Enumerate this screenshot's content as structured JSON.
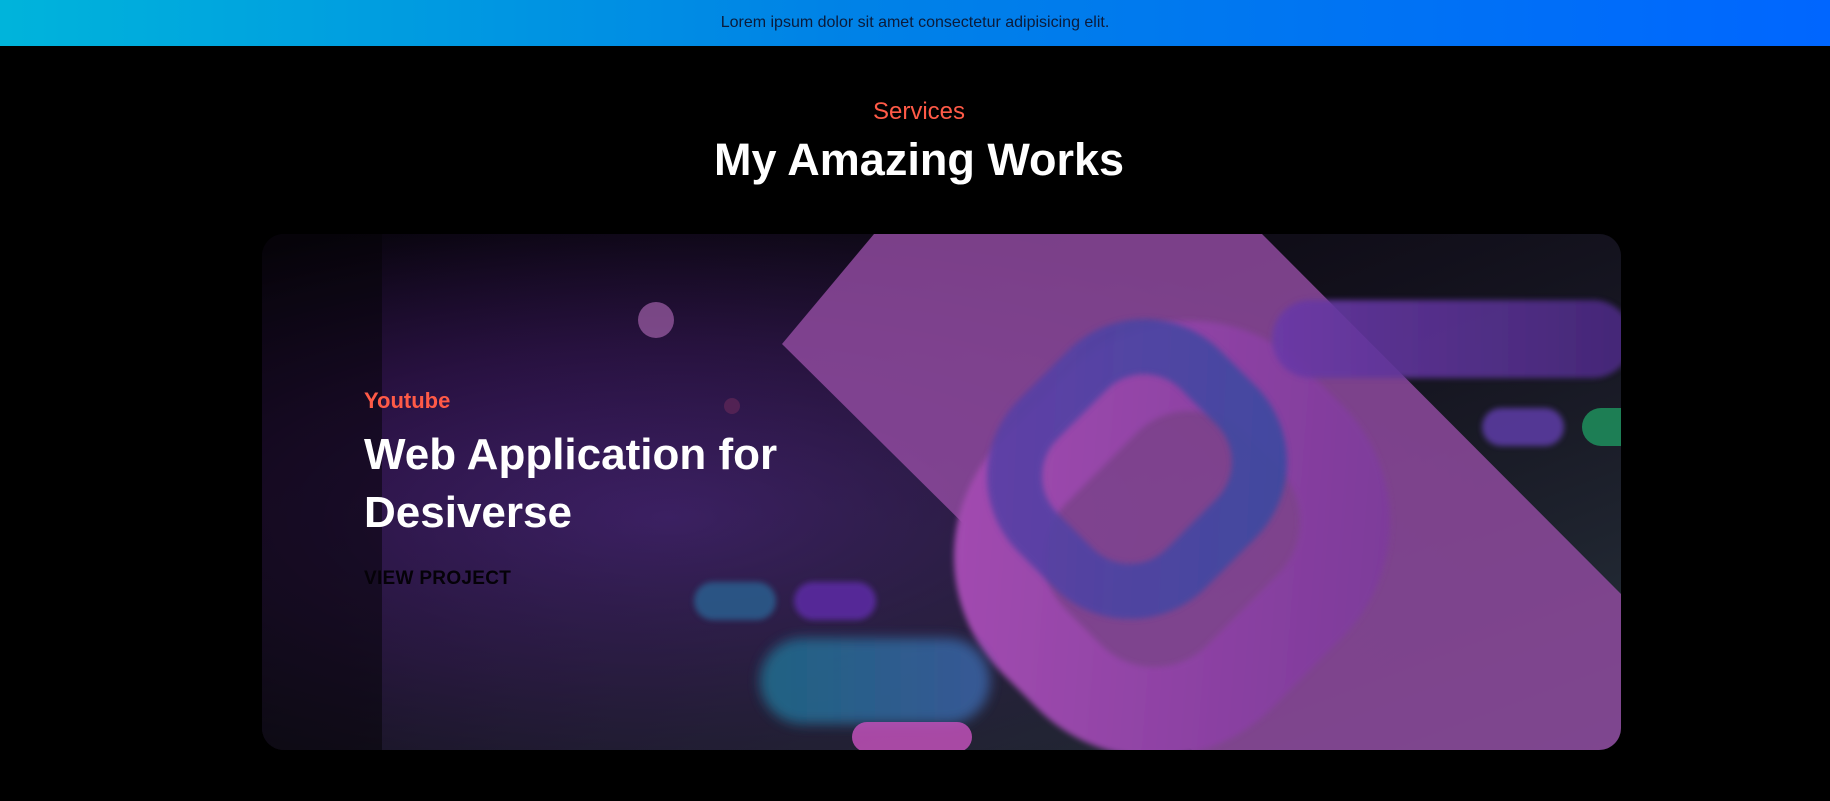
{
  "banner": {
    "text": "Lorem ipsum dolor sit amet consectetur adipisicing elit."
  },
  "section": {
    "eyebrow": "Services",
    "title": "My Amazing Works"
  },
  "project": {
    "eyebrow": "Youtube",
    "title_line1": "Web Application for",
    "title_line2": "Desiverse",
    "cta_label": "VIEW PROJECT"
  },
  "colors": {
    "accent": "#ff5a47",
    "banner_start": "#00b4db",
    "banner_end": "#0066ff",
    "background": "#000000"
  }
}
